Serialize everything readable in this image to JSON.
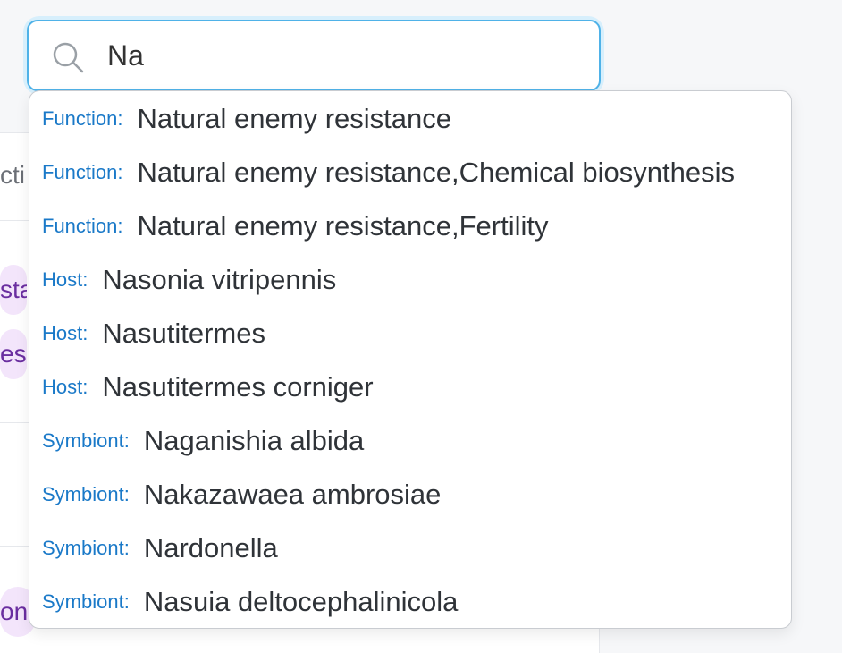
{
  "search": {
    "value": "Na",
    "accent_color": "#4fb2e8"
  },
  "background": {
    "fragments": [
      "cti",
      "sta",
      "esi",
      "on"
    ]
  },
  "suggestions": [
    {
      "type": "Function:",
      "value": "Natural enemy resistance"
    },
    {
      "type": "Function:",
      "value": "Natural enemy resistance,Chemical biosynthesis"
    },
    {
      "type": "Function:",
      "value": "Natural enemy resistance,Fertility"
    },
    {
      "type": "Host:",
      "value": "Nasonia vitripennis"
    },
    {
      "type": "Host:",
      "value": "Nasutitermes"
    },
    {
      "type": "Host:",
      "value": "Nasutitermes corniger"
    },
    {
      "type": "Symbiont:",
      "value": "Naganishia albida"
    },
    {
      "type": "Symbiont:",
      "value": "Nakazawaea ambrosiae"
    },
    {
      "type": "Symbiont:",
      "value": "Nardonella"
    },
    {
      "type": "Symbiont:",
      "value": "Nasuia deltocephalinicola"
    }
  ],
  "colors": {
    "type_label": "#1a79c8",
    "pill_bg": "#f3e5fb",
    "pill_text": "#6a2ea0"
  },
  "icons": {
    "search": "search-icon"
  }
}
